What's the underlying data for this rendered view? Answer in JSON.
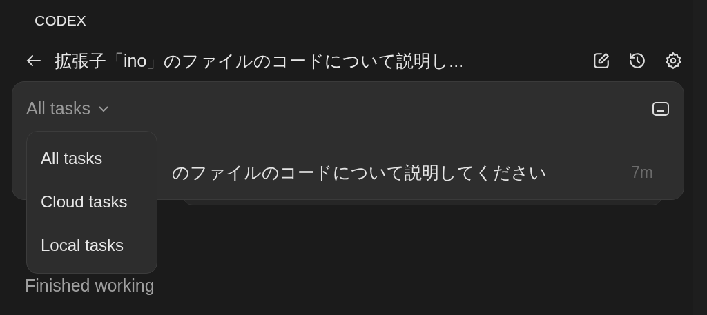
{
  "app": {
    "name": "CODEX"
  },
  "header": {
    "title": "拡張子「ino」のファイルのコードについて説明し..."
  },
  "filter": {
    "label": "All tasks",
    "expanded": true,
    "options": [
      {
        "label": "All tasks"
      },
      {
        "label": "Cloud tasks"
      },
      {
        "label": "Local tasks"
      }
    ]
  },
  "tasks": [
    {
      "title": "のファイルのコードについて説明してください",
      "age": "7m"
    }
  ],
  "status": "Finished working"
}
